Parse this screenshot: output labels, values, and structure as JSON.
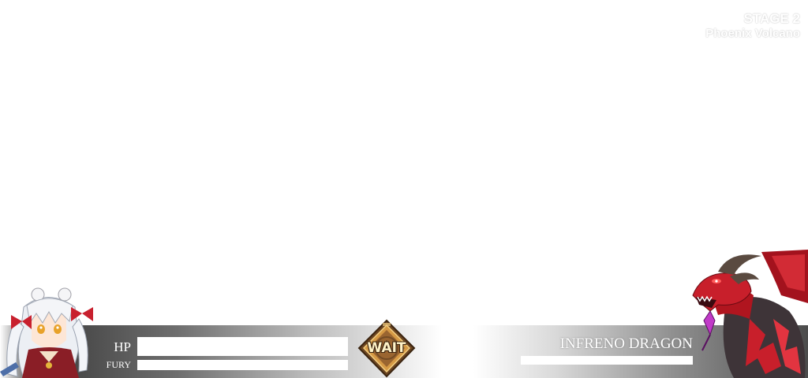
{
  "stage": {
    "title": "STAGE 2",
    "subtitle": "Phoenix Volcano"
  },
  "player": {
    "hp_label": "HP",
    "fury_label": "FURY",
    "hp_fraction": 1.0,
    "fury_fraction": 1.0,
    "portrait_icon": "hero-girl-icon"
  },
  "center": {
    "status_label": "WAIT",
    "emblem_icon": "wait-emblem-icon"
  },
  "enemy": {
    "name": "INFRENO DRAGON",
    "hp_fraction": 1.0,
    "portrait_icon": "red-dragon-icon"
  },
  "colors": {
    "bar_fill": "#ffffff",
    "emblem_gold": "#c78a3a",
    "emblem_brown": "#5a3a1c",
    "dragon_red": "#c8202a"
  }
}
